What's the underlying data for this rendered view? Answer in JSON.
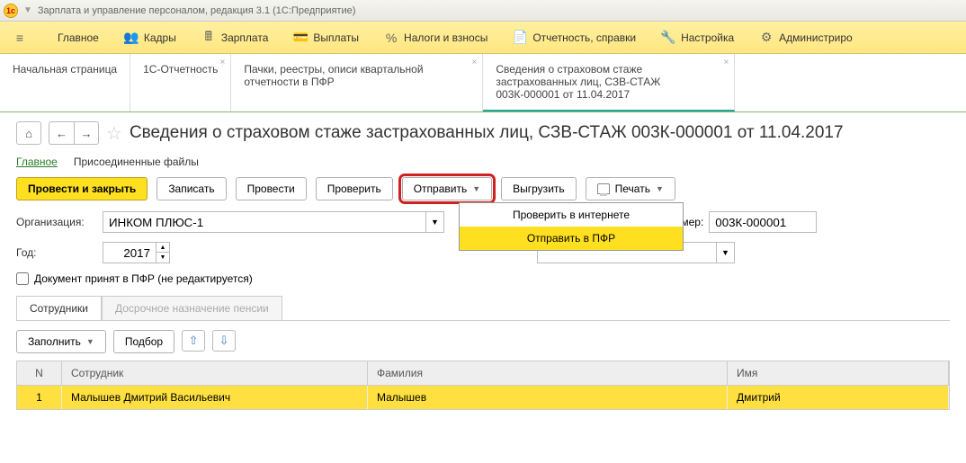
{
  "titlebar": {
    "title": "Зарплата и управление персоналом, редакция 3.1  (1С:Предприятие)"
  },
  "menu": {
    "main": "Главное",
    "kadry": "Кадры",
    "zarplata": "Зарплата",
    "vyplaty": "Выплаты",
    "nalogi": "Налоги и взносы",
    "otchet": "Отчетность, справки",
    "nastroika": "Настройка",
    "admin": "Администриро"
  },
  "tabs": {
    "start": "Начальная страница",
    "t1": "1С-Отчетность",
    "t2": "Пачки, реестры, описи квартальной отчетности в ПФР",
    "t3": "Сведения о страховом стаже застрахованных лиц, СЗВ-СТАЖ 003К-000001 от 11.04.2017"
  },
  "doc": {
    "title": "Сведения о страховом стаже застрахованных лиц, СЗВ-СТАЖ 003К-000001 от 11.04.2017"
  },
  "subtabs": {
    "main": "Главное",
    "files": "Присоединенные файлы"
  },
  "toolbar": {
    "post_close": "Провести и закрыть",
    "write": "Записать",
    "post": "Провести",
    "check": "Проверить",
    "send": "Отправить",
    "upload": "Выгрузить",
    "print": "Печать"
  },
  "dropdown": {
    "check_online": "Проверить в интернете",
    "send_pfr": "Отправить в ПФР"
  },
  "form": {
    "org_label": "Организация:",
    "org_value": "ИНКОМ ПЛЮС-1",
    "year_label": "Год:",
    "year_value": "2017",
    "num_label": "Номер:",
    "num_value": "003К-000001",
    "chk_label": "Документ принят в ПФР (не редактируется)"
  },
  "innertabs": {
    "emp": "Сотрудники",
    "pension": "Досрочное назначение пенсии"
  },
  "tbltoolbar": {
    "fill": "Заполнить",
    "pick": "Подбор"
  },
  "grid": {
    "h_n": "N",
    "h_emp": "Сотрудник",
    "h_fam": "Фамилия",
    "h_name": "Имя",
    "rows": [
      {
        "n": "1",
        "emp": "Малышев Дмитрий Васильевич",
        "fam": "Малышев",
        "name": "Дмитрий"
      }
    ]
  }
}
